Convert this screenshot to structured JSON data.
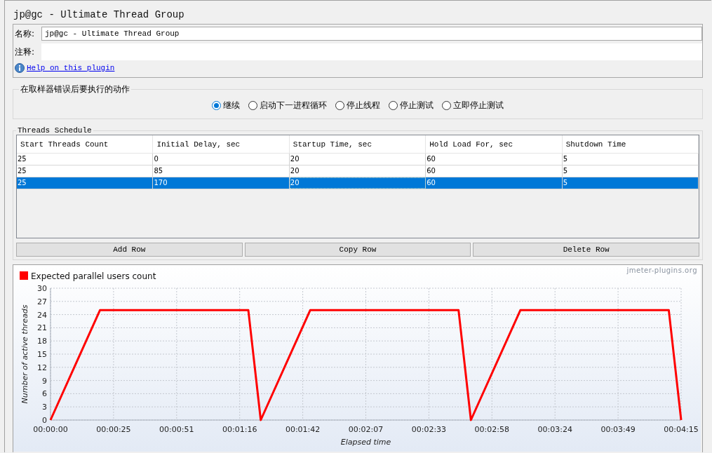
{
  "page_title": "jp@gc - Ultimate Thread Group",
  "name_field": {
    "label": "名称:",
    "value": "jp@gc - Ultimate Thread Group"
  },
  "comment_field": {
    "label": "注释:"
  },
  "help_link": "Help on this plugin",
  "error_action": {
    "title": "在取样器错误后要执行的动作",
    "options": [
      {
        "label": "继续",
        "selected": true
      },
      {
        "label": "启动下一进程循环",
        "selected": false
      },
      {
        "label": "停止线程",
        "selected": false
      },
      {
        "label": "停止测试",
        "selected": false
      },
      {
        "label": "立即停止测试",
        "selected": false
      }
    ]
  },
  "schedule": {
    "title": "Threads Schedule",
    "columns": [
      "Start Threads Count",
      "Initial Delay, sec",
      "Startup Time, sec",
      "Hold Load For, sec",
      "Shutdown Time"
    ],
    "rows": [
      {
        "cells": [
          "25",
          "0",
          "20",
          "60",
          "5"
        ],
        "selected": false
      },
      {
        "cells": [
          "25",
          "85",
          "20",
          "60",
          "5"
        ],
        "selected": false
      },
      {
        "cells": [
          "25",
          "170",
          "20",
          "60",
          "5"
        ],
        "selected": true
      }
    ],
    "buttons": [
      "Add Row",
      "Copy Row",
      "Delete Row"
    ]
  },
  "chart": {
    "credit": "jmeter-plugins.org",
    "chart_data": {
      "type": "line",
      "grid": true,
      "xlabel": "Elapsed time",
      "ylabel": "Number of active threads",
      "x": [
        0,
        20,
        80,
        85,
        105,
        165,
        170,
        190,
        250,
        255
      ],
      "series": [
        {
          "name": "Expected parallel users count",
          "color": "#ff0000",
          "values": [
            0,
            25,
            25,
            0,
            25,
            25,
            0,
            25,
            25,
            0
          ]
        }
      ],
      "xlim": [
        0,
        255
      ],
      "ylim": [
        0,
        30
      ],
      "xticks": [
        {
          "value": 0,
          "label": "00:00:00"
        },
        {
          "value": 25.5,
          "label": "00:00:25"
        },
        {
          "value": 51,
          "label": "00:00:51"
        },
        {
          "value": 76.5,
          "label": "00:01:16"
        },
        {
          "value": 102,
          "label": "00:01:42"
        },
        {
          "value": 127.5,
          "label": "00:02:07"
        },
        {
          "value": 153,
          "label": "00:02:33"
        },
        {
          "value": 178.5,
          "label": "00:02:58"
        },
        {
          "value": 204,
          "label": "00:03:24"
        },
        {
          "value": 229.5,
          "label": "00:03:49"
        },
        {
          "value": 255,
          "label": "00:04:15"
        }
      ],
      "yticks": [
        0,
        3,
        6,
        9,
        12,
        15,
        18,
        21,
        24,
        27,
        30
      ]
    }
  }
}
